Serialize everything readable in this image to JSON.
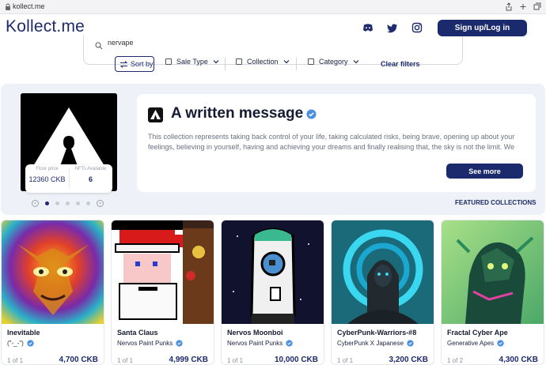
{
  "browser": {
    "url": "kollect.me"
  },
  "header": {
    "logo_text": "Kollect.me",
    "search_value": "nervape",
    "signup_label": "Sign up/Log in",
    "social_icons": [
      "discord-icon",
      "twitter-icon",
      "instagram-icon"
    ]
  },
  "filters": {
    "sort_label": "Sort by",
    "sale_type": "Sale Type",
    "collection": "Collection",
    "category": "Category",
    "clear": "Clear filters"
  },
  "featured": {
    "title": "A written message",
    "description": "This collection represents taking back control of your life, taking calculated risks, being brave, opening up about your feelings, believing in yourself, having and achieving your dreams and finally realising that, the sky is not the limit. We se...",
    "floor_label": "Floor price",
    "floor_value": "12360 CKB",
    "nfts_label": "NFTs Available",
    "nfts_value": "6",
    "see_more": "See more",
    "section_label": "FEATURED COLLECTIONS",
    "page_active": 1,
    "page_count": 6
  },
  "cards": [
    {
      "name": "Inevitable",
      "collection": "(\"-_-\")",
      "edition": "1 of 1",
      "price": "4,700 CKB"
    },
    {
      "name": "Santa Claus",
      "collection": "Nervos Paint Punks",
      "edition": "1 of 1",
      "price": "4,999 CKB"
    },
    {
      "name": "Nervos Moonboi",
      "collection": "Nervos Paint Punks",
      "edition": "1 of 1",
      "price": "10,000 CKB"
    },
    {
      "name": "CyberPunk-Warriors-#8",
      "collection": "CyberPunk X Japanese",
      "edition": "1 of 1",
      "price": "3,200 CKB"
    },
    {
      "name": "Fractal Cyber Ape",
      "collection": "Generative Apes",
      "edition": "1 of 2",
      "price": "4,300 CKB"
    }
  ],
  "colors": {
    "brand": "#1a2a6c",
    "verified": "#4a8fe0",
    "panel": "#eef1f7"
  }
}
